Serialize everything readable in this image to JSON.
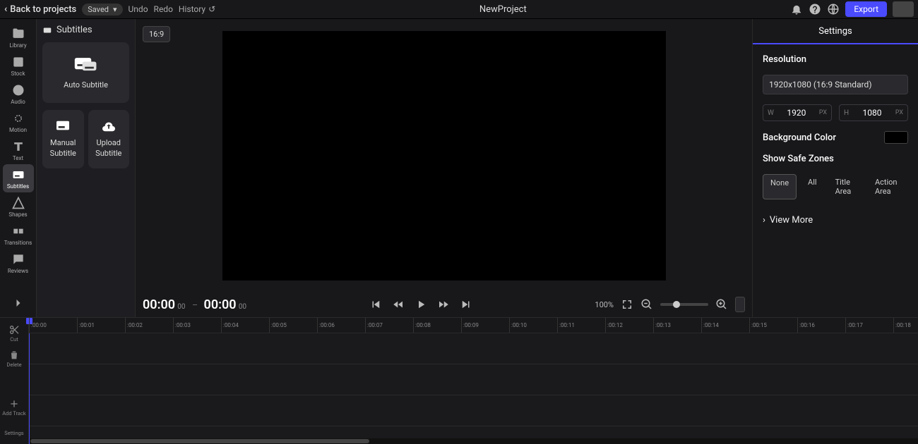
{
  "topbar": {
    "back_label": "Back to projects",
    "saved_label": "Saved",
    "undo_label": "Undo",
    "redo_label": "Redo",
    "history_label": "History",
    "project_title": "NewProject",
    "export_label": "Export"
  },
  "leftbar": {
    "items": [
      {
        "label": "Library"
      },
      {
        "label": "Stock"
      },
      {
        "label": "Audio"
      },
      {
        "label": "Motion"
      },
      {
        "label": "Text"
      },
      {
        "label": "Subtitles"
      },
      {
        "label": "Shapes"
      },
      {
        "label": "Transitions"
      },
      {
        "label": "Reviews"
      }
    ],
    "settings_label": "Settings"
  },
  "sub_panel": {
    "title": "Subtitles",
    "auto_label": "Auto Subtitle",
    "manual_label": "Manual Subtitle",
    "upload_label": "Upload Subtitle"
  },
  "preview": {
    "ratio": "16:9",
    "time_current": "00:00",
    "time_current_ms": "00",
    "time_total": "00:00",
    "time_total_ms": "00",
    "zoom_pct": "100%"
  },
  "settings": {
    "tab_label": "Settings",
    "resolution_title": "Resolution",
    "resolution_value": "1920x1080 (16:9 Standard)",
    "width_label": "W",
    "width_value": "1920",
    "px": "PX",
    "height_label": "H",
    "height_value": "1080",
    "bg_title": "Background Color",
    "safe_title": "Show Safe Zones",
    "safe_options": [
      "None",
      "All",
      "Title Area",
      "Action Area"
    ],
    "view_more": "View More"
  },
  "timeline": {
    "cut_label": "Cut",
    "delete_label": "Delete",
    "add_track_label": "Add Track",
    "marks": [
      ":00:00",
      ":00:01",
      ":00:02",
      ":00:03",
      ":00:04",
      ":00:05",
      ":00:06",
      ":00:07",
      ":00:08",
      ":00:09",
      ":00:10",
      ":00:11",
      ":00:12",
      ":00:13",
      ":00:14",
      ":00:15",
      ":00:16",
      ":00:17",
      ":00:18"
    ]
  }
}
